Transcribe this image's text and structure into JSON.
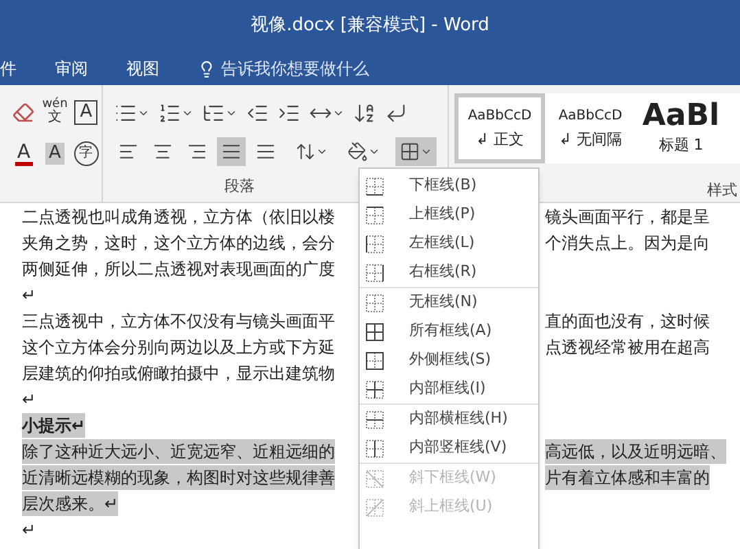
{
  "window": {
    "title": "视像.docx [兼容模式]  -  Word"
  },
  "tabs": [
    {
      "label": "件"
    },
    {
      "label": "审阅"
    },
    {
      "label": "视图"
    }
  ],
  "tell_me": "告诉我你想要做什么",
  "font_tools": [
    {
      "kind": "clear"
    },
    {
      "kind": "pinyin",
      "text": "wén",
      "sub": "文"
    },
    {
      "kind": "border_char",
      "text": "A"
    },
    {
      "kind": "font_color",
      "text": "A",
      "color": "#c00000"
    },
    {
      "kind": "shading_char",
      "text": "A"
    },
    {
      "kind": "enclose",
      "text": "字"
    }
  ],
  "paragraph_row1": [
    {
      "kind": "bullets"
    },
    {
      "kind": "numbering"
    },
    {
      "kind": "multilevel"
    },
    {
      "kind": "outdent"
    },
    {
      "kind": "indent"
    },
    {
      "kind": "asian"
    },
    {
      "kind": "sort"
    },
    {
      "kind": "marks"
    }
  ],
  "alignment": [
    {
      "kind": "left",
      "selected": false
    },
    {
      "kind": "center",
      "selected": false
    },
    {
      "kind": "right",
      "selected": false
    },
    {
      "kind": "justify",
      "selected": true
    },
    {
      "kind": "distributed",
      "selected": false
    }
  ],
  "paragraph_row2": [
    {
      "kind": "spacing",
      "selected": false
    },
    {
      "kind": "shading",
      "selected": false
    },
    {
      "kind": "borders",
      "selected": true
    }
  ],
  "group_labels": {
    "paragraph": "段落",
    "styles": "样式"
  },
  "styles": [
    {
      "sample": "AaBbCcD",
      "name": "↲ 正文",
      "selected": true,
      "kind": "normal"
    },
    {
      "sample": "AaBbCcD",
      "name": "↲ 无间隔",
      "selected": false,
      "kind": "normal"
    },
    {
      "sample": "AaBl",
      "name": "标题 1",
      "selected": false,
      "kind": "heading"
    }
  ],
  "document": [
    {
      "left": "二点透视也叫成角透视，立方体（依旧以楼",
      "right": "镜头画面平行，都是呈",
      "highlighted": false,
      "bold": false
    },
    {
      "left": "夹角之势，这时，这个立方体的边线，会分",
      "right": "个消失点上。因为是向",
      "highlighted": false,
      "bold": false
    },
    {
      "left": "两侧延伸，所以二点透视对表现画面的广度",
      "highlighted": false,
      "bold": false
    },
    {
      "left": "↵",
      "highlighted": false,
      "bold": false
    },
    {
      "left": "三点透视中，立方体不仅没有与镜头画面平",
      "right": "直的面也没有，这时候",
      "highlighted": false,
      "bold": false
    },
    {
      "left": "这个立方体会分别向两边以及上方或下方延",
      "right": "点透视经常被用在超高",
      "highlighted": false,
      "bold": false
    },
    {
      "left": "层建筑的仰拍或俯瞰拍摄中，显示出建筑物",
      "highlighted": false,
      "bold": false
    },
    {
      "left": "↵",
      "highlighted": false,
      "bold": false
    },
    {
      "left": "小提示↵",
      "highlighted": true,
      "bold": true
    },
    {
      "left": "除了这种近大远小、近宽远窄、近粗远细的",
      "right": "高远低，以及近明远暗、",
      "highlighted": true,
      "bold": false
    },
    {
      "left": "近清晰远模糊的现象，构图时对这些规律善",
      "right": "片有着立体感和丰富的",
      "highlighted": true,
      "bold": false
    },
    {
      "left": "层次感来。↵",
      "highlighted": true,
      "bold": false
    },
    {
      "left": "↵",
      "highlighted": false,
      "bold": false
    }
  ],
  "border_menu": [
    [
      {
        "label": "下框线(B)",
        "kind": "bottom",
        "disabled": false
      },
      {
        "label": "上框线(P)",
        "kind": "top",
        "disabled": false
      },
      {
        "label": "左框线(L)",
        "kind": "left",
        "disabled": false
      },
      {
        "label": "右框线(R)",
        "kind": "right",
        "disabled": false
      }
    ],
    [
      {
        "label": "无框线(N)",
        "kind": "none",
        "disabled": false
      },
      {
        "label": "所有框线(A)",
        "kind": "all",
        "disabled": false
      },
      {
        "label": "外侧框线(S)",
        "kind": "outside",
        "disabled": false
      },
      {
        "label": "内部框线(I)",
        "kind": "inside",
        "disabled": false
      }
    ],
    [
      {
        "label": "内部横框线(H)",
        "kind": "inside_h",
        "disabled": false
      },
      {
        "label": "内部竖框线(V)",
        "kind": "inside_v",
        "disabled": false
      }
    ],
    [
      {
        "label": "斜下框线(W)",
        "kind": "diag_down",
        "disabled": true
      },
      {
        "label": "斜上框线(U)",
        "kind": "diag_up",
        "disabled": true
      }
    ]
  ]
}
